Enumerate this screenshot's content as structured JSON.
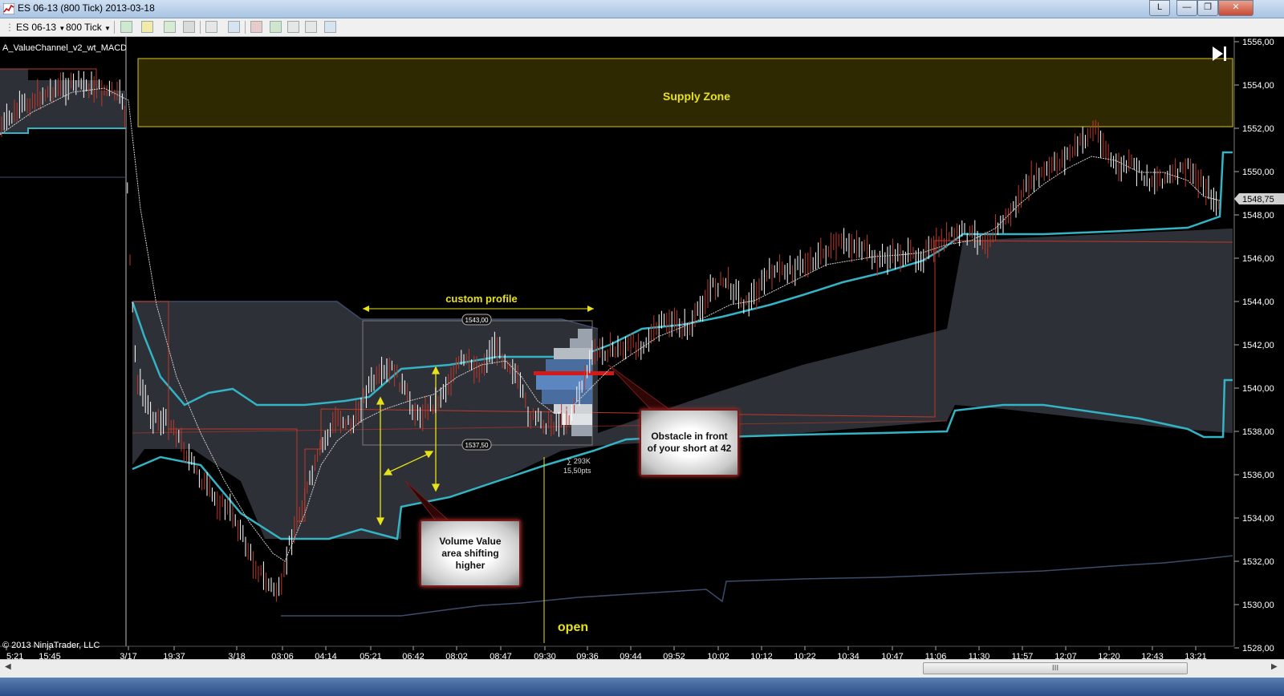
{
  "window": {
    "title": "ES 06-13 (800 Tick)  2013-03-18",
    "buttons": {
      "layout": "L",
      "minimize": "—",
      "maximize": "❐",
      "close": "✕"
    }
  },
  "toolbar": {
    "instrument": "ES 06-13",
    "interval": "800 Tick",
    "icons": [
      "bar-style-icon",
      "draw-tool-icon",
      "add-indicator-icon",
      "strategy-icon",
      "cursor-icon",
      "zoom-icon",
      "chart-trader-icon",
      "data-box-icon",
      "properties-icon",
      "print-icon",
      "panel-icon"
    ]
  },
  "chart": {
    "indicator_label": "A_ValueChannel_v2_wt_MACD",
    "copyright": "© 2013 NinjaTrader, LLC",
    "last_price_label": "1548,75",
    "y_ticks": [
      "1556,00",
      "1554,00",
      "1552,00",
      "1550,00",
      "1548,00",
      "1546,00",
      "1544,00",
      "1542,00",
      "1540,00",
      "1538,00",
      "1536,00",
      "1534,00",
      "1532,00",
      "1530,00",
      "1528,00"
    ],
    "x_ticks": [
      "5:21",
      "15:45",
      "3/17",
      "19:37",
      "3/18",
      "03:06",
      "04:14",
      "05:21",
      "06:42",
      "08:02",
      "08:47",
      "09:30",
      "09:36",
      "09:44",
      "09:52",
      "10:02",
      "10:12",
      "10:22",
      "10:34",
      "10:47",
      "11:06",
      "11:30",
      "11:57",
      "12:07",
      "12:20",
      "12:43",
      "13:21"
    ],
    "supply_zone_label": "Supply Zone",
    "custom_profile_label": "custom profile",
    "profile_high": "1543,00",
    "profile_low": "1537,50",
    "profile_volume": "∑ 293K",
    "profile_range": "15,50pts",
    "open_label": "open",
    "callout_obstacle": "Obstacle in front of your short at 42",
    "callout_volume": "Volume Value area shifting higher",
    "colors": {
      "supply_zone": "#2e2900",
      "supply_border": "#d7c21a",
      "channel": "#33b3c4",
      "value_fill": "#2d3036",
      "poc": "#d51919",
      "price_up": "#ffffff",
      "price_down": "#c0392b",
      "annotation": "#e7e21a"
    }
  },
  "scrollbar": {
    "thumb_label": "III"
  }
}
